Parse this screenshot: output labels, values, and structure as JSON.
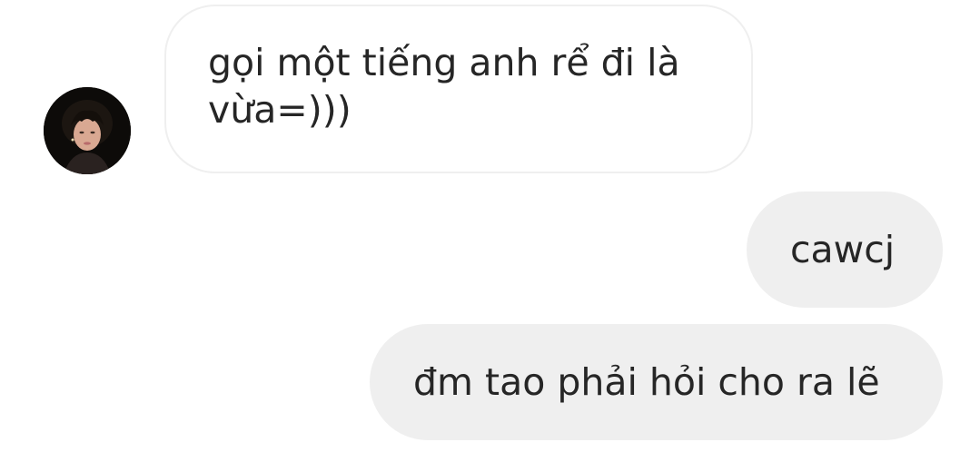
{
  "conversation": {
    "contact": {
      "avatar_icon": "profile-photo-icon"
    },
    "messages": [
      {
        "direction": "incoming",
        "lines": [
          "gọi một tiếng anh rể đi là",
          "vừa=)))"
        ]
      },
      {
        "direction": "outgoing",
        "text": "cawcj"
      },
      {
        "direction": "outgoing",
        "text": "đm tao phải hỏi cho ra lẽ"
      }
    ]
  },
  "colors": {
    "background": "#ffffff",
    "incoming_bubble_bg": "#ffffff",
    "incoming_bubble_border": "#efefef",
    "outgoing_bubble_bg": "#efefef",
    "text": "#262626"
  }
}
